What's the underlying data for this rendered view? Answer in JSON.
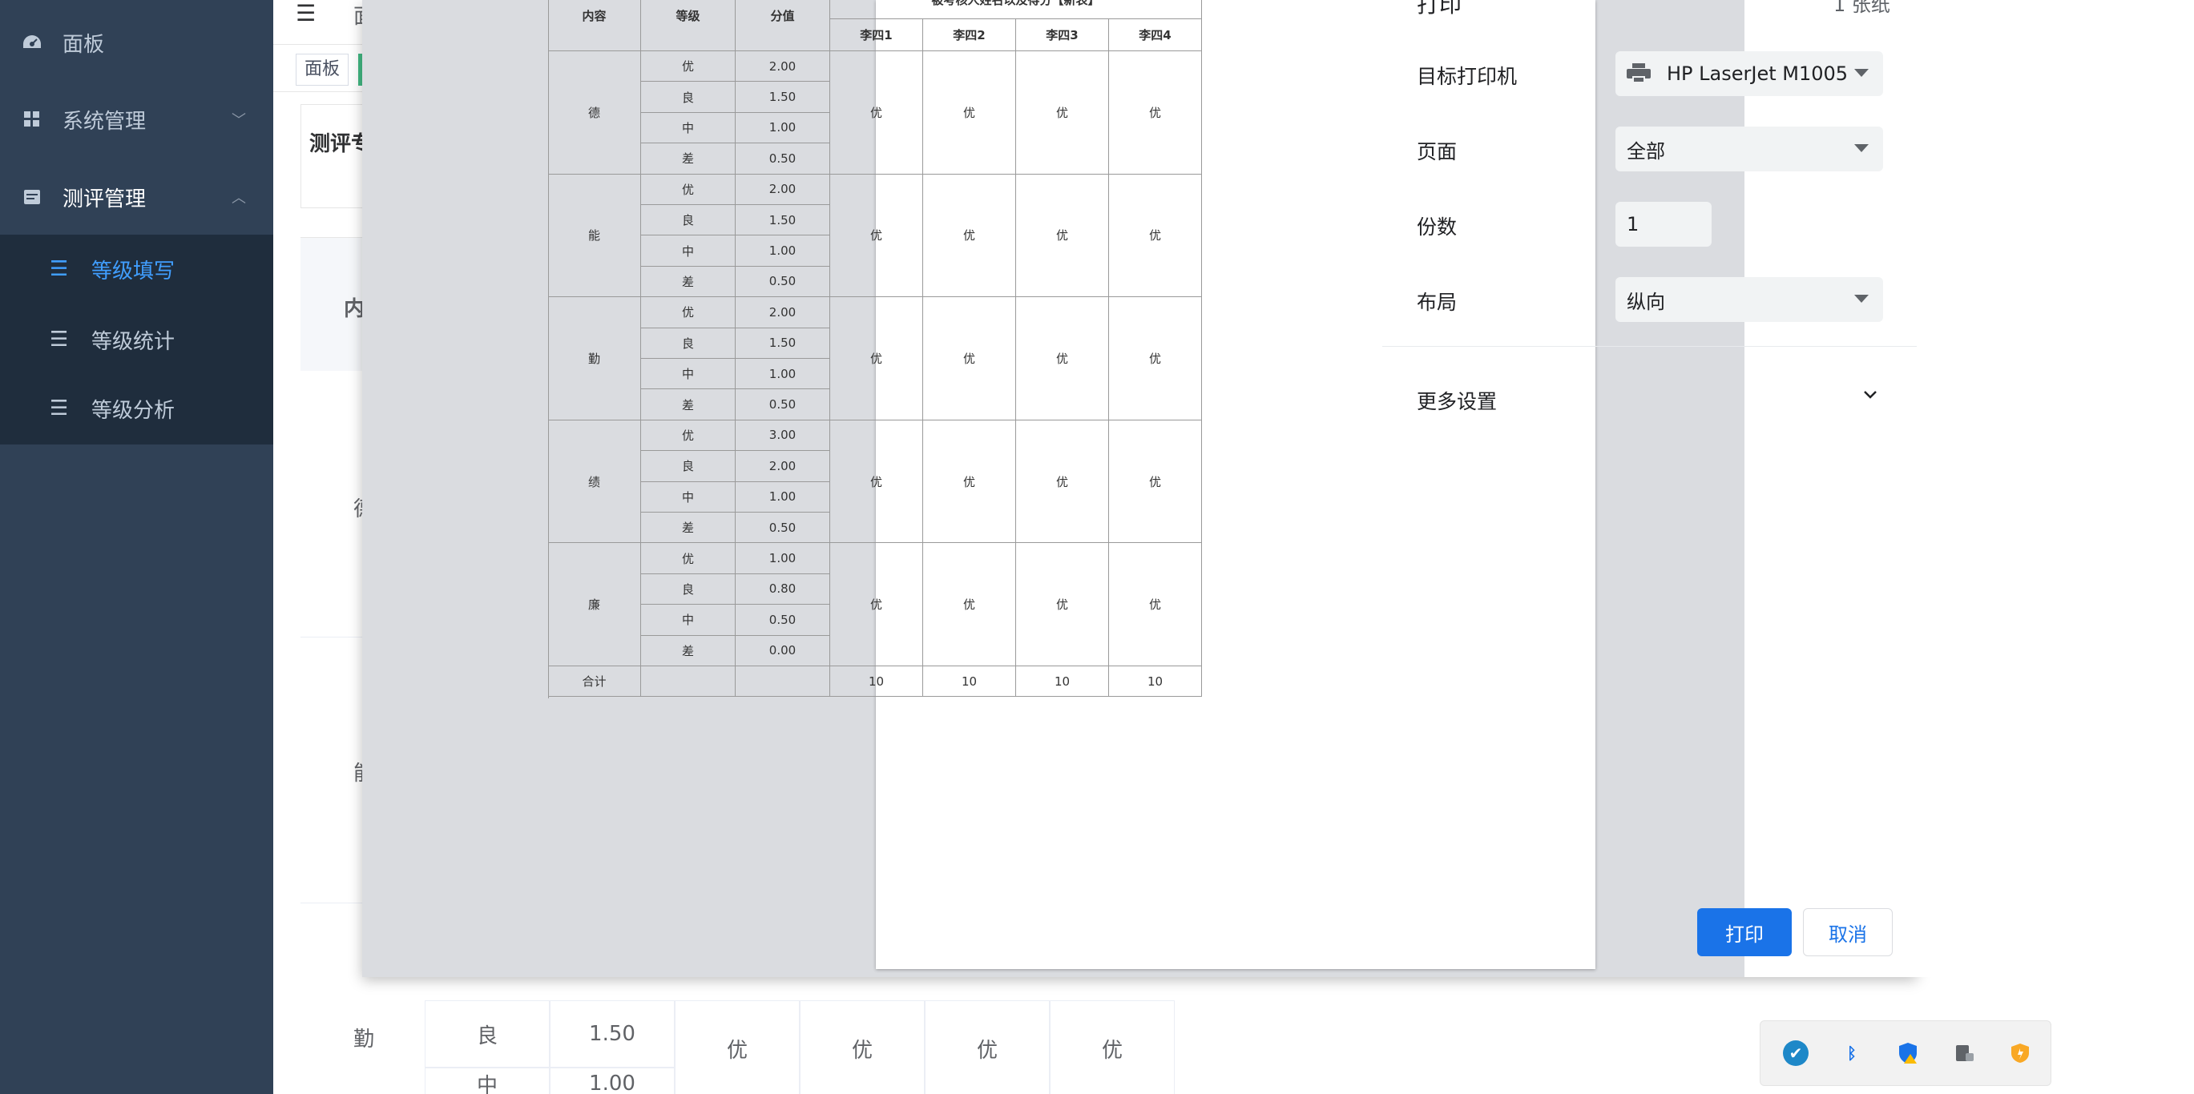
{
  "sidebar": {
    "items": [
      {
        "label": "面板",
        "icon": "dashboard-icon"
      },
      {
        "label": "系统管理",
        "icon": "grid-icon"
      },
      {
        "label": "测评管理",
        "icon": "document-icon"
      }
    ],
    "submenu": [
      {
        "label": "等级填写",
        "active": true
      },
      {
        "label": "等级统计",
        "active": false
      },
      {
        "label": "等级分析",
        "active": false
      }
    ],
    "accent_color": "#409eff"
  },
  "background": {
    "header_first_char": "面",
    "tag_label": "面板",
    "section_title": "测评专",
    "table_header_partial": "内",
    "row_labels": [
      "德",
      "能",
      "勤"
    ],
    "bottom_rows": [
      {
        "grade": "良",
        "score": "1.50"
      },
      {
        "grade": "中",
        "score": "1.00"
      }
    ],
    "bottom_grade_values": [
      "优",
      "优",
      "优",
      "优"
    ]
  },
  "print_dialog": {
    "title_partial": "打印",
    "sheets_partial": "1 张纸",
    "settings": {
      "printer_label": "目标打印机",
      "printer_value": "HP LaserJet M1005",
      "pages_label": "页面",
      "pages_value": "全部",
      "copies_label": "份数",
      "copies_value": "1",
      "layout_label": "布局",
      "layout_value": "纵向",
      "more_settings_label": "更多设置"
    },
    "buttons": {
      "print": "打印",
      "cancel": "取消"
    },
    "primary_color": "#1a73e8"
  },
  "preview_table": {
    "header_caption": "被考核人姓名以及得分【新表】",
    "col_headers": [
      "内容",
      "等级",
      "分值"
    ],
    "person_headers": [
      "李四1",
      "李四2",
      "李四3",
      "李四4"
    ],
    "groups": [
      {
        "content": "德",
        "rows": [
          [
            "优",
            "2.00"
          ],
          [
            "良",
            "1.50"
          ],
          [
            "中",
            "1.00"
          ],
          [
            "差",
            "0.50"
          ]
        ],
        "grades": [
          "优",
          "优",
          "优",
          "优"
        ]
      },
      {
        "content": "能",
        "rows": [
          [
            "优",
            "2.00"
          ],
          [
            "良",
            "1.50"
          ],
          [
            "中",
            "1.00"
          ],
          [
            "差",
            "0.50"
          ]
        ],
        "grades": [
          "优",
          "优",
          "优",
          "优"
        ]
      },
      {
        "content": "勤",
        "rows": [
          [
            "优",
            "2.00"
          ],
          [
            "良",
            "1.50"
          ],
          [
            "中",
            "1.00"
          ],
          [
            "差",
            "0.50"
          ]
        ],
        "grades": [
          "优",
          "优",
          "优",
          "优"
        ]
      },
      {
        "content": "绩",
        "rows": [
          [
            "优",
            "3.00"
          ],
          [
            "良",
            "2.00"
          ],
          [
            "中",
            "1.00"
          ],
          [
            "差",
            "0.50"
          ]
        ],
        "grades": [
          "优",
          "优",
          "优",
          "优"
        ]
      },
      {
        "content": "廉",
        "rows": [
          [
            "优",
            "1.00"
          ],
          [
            "良",
            "0.80"
          ],
          [
            "中",
            "0.50"
          ],
          [
            "差",
            "0.00"
          ]
        ],
        "grades": [
          "优",
          "优",
          "优",
          "优"
        ]
      }
    ],
    "total_label": "合计",
    "totals": [
      "10",
      "10",
      "10",
      "10"
    ]
  },
  "tray": {
    "icons": [
      "shield-check-icon",
      "bluetooth-icon",
      "security-warning-icon",
      "device-icon",
      "notification-shield-icon"
    ]
  }
}
